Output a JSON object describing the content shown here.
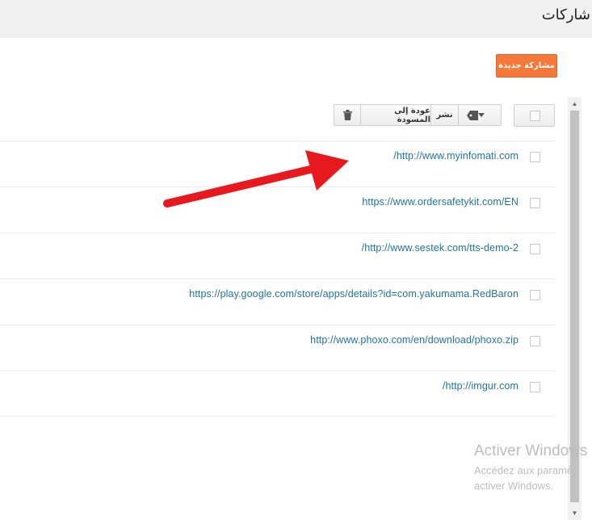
{
  "header": {
    "title": "شاركات"
  },
  "actions": {
    "new_post_label": "مشاركة جديدة"
  },
  "toolbar": {
    "revert_to_draft_label": "عودة إلى المسودة",
    "publish_label": "نشر",
    "icons": [
      "trash-icon",
      "chevron-down-icon",
      "tag-icon"
    ]
  },
  "posts": [
    {
      "title": "/http://www.myinfomati.com"
    },
    {
      "title": "https://www.ordersafetykit.com/EN"
    },
    {
      "title": "/http://www.sestek.com/tts-demo-2"
    },
    {
      "title": "https://play.google.com/store/apps/details?id=com.yakumama.RedBaron"
    },
    {
      "title": "http://www.phoxo.com/en/download/phoxo.zip"
    },
    {
      "title": "/http://imgur.com"
    }
  ],
  "watermark": {
    "title": "Activer Windows",
    "line1": "Accédez aux paramè",
    "line2": "activer Windows."
  },
  "colors": {
    "accent": "#f4793a",
    "link": "#21759b",
    "annotation_arrow": "#e8191e"
  }
}
